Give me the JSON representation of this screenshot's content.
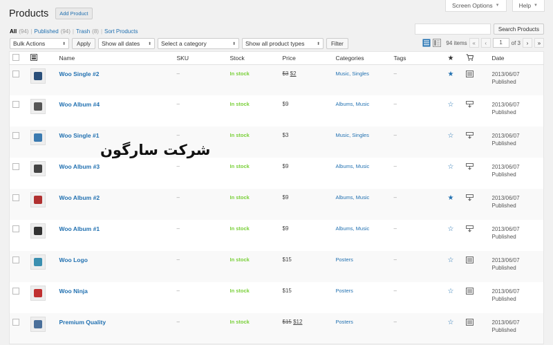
{
  "header": {
    "title": "Products",
    "add_button": "Add Product",
    "screen_options": "Screen Options",
    "help": "Help"
  },
  "filters": {
    "all": "All",
    "all_count": "(94)",
    "published": "Published",
    "published_count": "(94)",
    "trash": "Trash",
    "trash_count": "(8)",
    "sort": "Sort Products"
  },
  "search": {
    "button": "Search Products",
    "placeholder": ""
  },
  "toolbar": {
    "bulk_actions": "Bulk Actions",
    "apply": "Apply",
    "dates": "Show all dates",
    "category": "Select a category",
    "types": "Show all product types",
    "filter": "Filter"
  },
  "pagination": {
    "items": "94 items",
    "first": "«",
    "prev": "‹",
    "current": "1",
    "of": "of 3",
    "next": "›",
    "last": "»"
  },
  "columns": {
    "name": "Name",
    "sku": "SKU",
    "stock": "Stock",
    "price": "Price",
    "categories": "Categories",
    "tags": "Tags",
    "date": "Date"
  },
  "watermark": "شرکت سارگون",
  "products": [
    {
      "name": "Woo Single #2",
      "sku": "–",
      "stock": "In stock",
      "price_old": "$3",
      "price": "$2",
      "categories": "Music, Singles",
      "tags": "–",
      "featured": true,
      "type": "downloadable",
      "date": "2013/06/07",
      "status": "Published",
      "thumb_color": "#2a4f7a"
    },
    {
      "name": "Woo Album #4",
      "sku": "–",
      "stock": "In stock",
      "price_old": "",
      "price": "$9",
      "categories": "Albums, Music",
      "tags": "–",
      "featured": false,
      "type": "virtual",
      "date": "2013/06/07",
      "status": "Published",
      "thumb_color": "#555555"
    },
    {
      "name": "Woo Single #1",
      "sku": "–",
      "stock": "In stock",
      "price_old": "",
      "price": "$3",
      "categories": "Music, Singles",
      "tags": "–",
      "featured": false,
      "type": "virtual",
      "date": "2013/06/07",
      "status": "Published",
      "thumb_color": "#3a7ab0"
    },
    {
      "name": "Woo Album #3",
      "sku": "–",
      "stock": "In stock",
      "price_old": "",
      "price": "$9",
      "categories": "Albums, Music",
      "tags": "–",
      "featured": false,
      "type": "virtual",
      "date": "2013/06/07",
      "status": "Published",
      "thumb_color": "#444444"
    },
    {
      "name": "Woo Album #2",
      "sku": "–",
      "stock": "In stock",
      "price_old": "",
      "price": "$9",
      "categories": "Albums, Music",
      "tags": "–",
      "featured": true,
      "type": "virtual",
      "date": "2013/06/07",
      "status": "Published",
      "thumb_color": "#b03030"
    },
    {
      "name": "Woo Album #1",
      "sku": "–",
      "stock": "In stock",
      "price_old": "",
      "price": "$9",
      "categories": "Albums, Music",
      "tags": "–",
      "featured": false,
      "type": "virtual",
      "date": "2013/06/07",
      "status": "Published",
      "thumb_color": "#333333"
    },
    {
      "name": "Woo Logo",
      "sku": "–",
      "stock": "In stock",
      "price_old": "",
      "price": "$15",
      "categories": "Posters",
      "tags": "–",
      "featured": false,
      "type": "simple",
      "date": "2013/06/07",
      "status": "Published",
      "thumb_color": "#3a8fb0"
    },
    {
      "name": "Woo Ninja",
      "sku": "–",
      "stock": "In stock",
      "price_old": "",
      "price": "$15",
      "categories": "Posters",
      "tags": "–",
      "featured": false,
      "type": "simple",
      "date": "2013/06/07",
      "status": "Published",
      "thumb_color": "#c03030"
    },
    {
      "name": "Premium Quality",
      "sku": "–",
      "stock": "In stock",
      "price_old": "$15",
      "price": "$12",
      "categories": "Posters",
      "tags": "–",
      "featured": false,
      "type": "simple",
      "date": "2013/06/07",
      "status": "Published",
      "thumb_color": "#4a6f9a"
    }
  ]
}
